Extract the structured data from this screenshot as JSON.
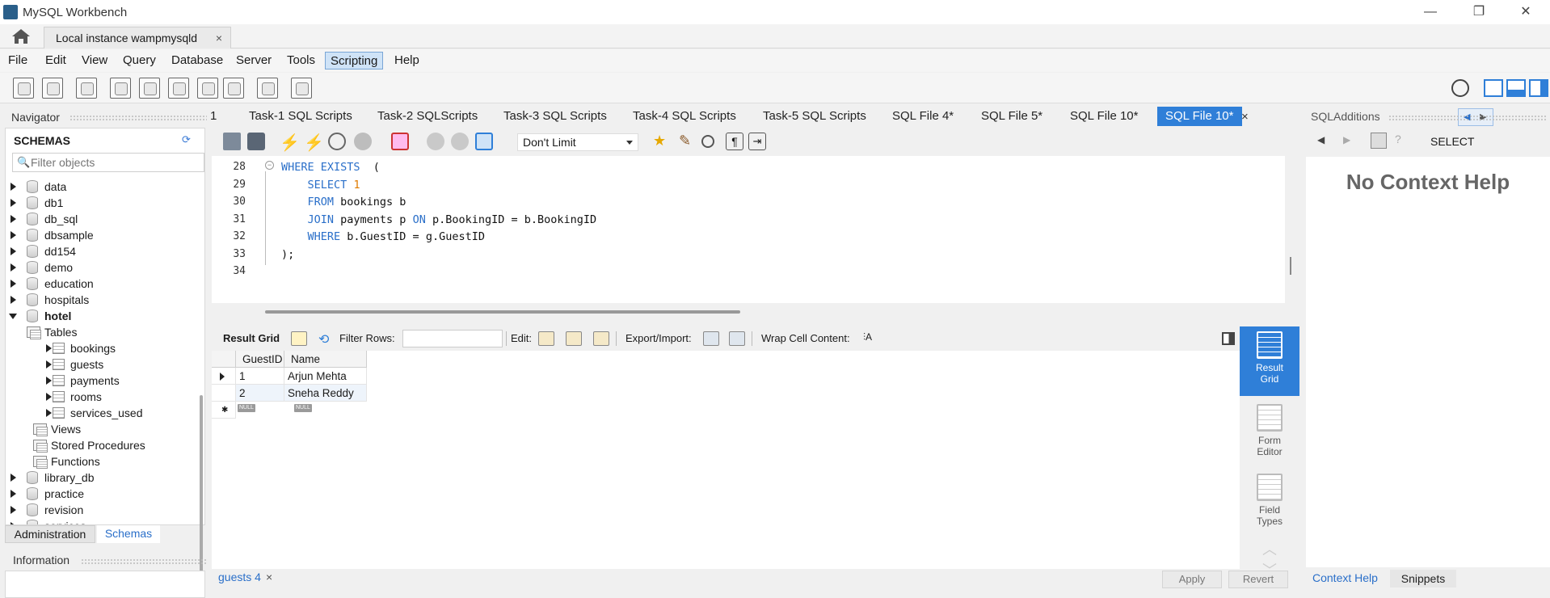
{
  "window": {
    "title": "MySQL Workbench",
    "minimize": "—",
    "restore": "❐",
    "close": "✕"
  },
  "connection_tab": {
    "label": "Local instance wampmysqld",
    "close": "×"
  },
  "menu": [
    "File",
    "Edit",
    "View",
    "Query",
    "Database",
    "Server",
    "Tools",
    "Scripting",
    "Help"
  ],
  "navigator": {
    "header": "Navigator",
    "schemas_title": "SCHEMAS",
    "filter_placeholder": "Filter objects",
    "tree": [
      {
        "label": "data",
        "level": 0,
        "expanded": false,
        "type": "schema"
      },
      {
        "label": "db1",
        "level": 0,
        "expanded": false,
        "type": "schema"
      },
      {
        "label": "db_sql",
        "level": 0,
        "expanded": false,
        "type": "schema"
      },
      {
        "label": "dbsample",
        "level": 0,
        "expanded": false,
        "type": "schema"
      },
      {
        "label": "dd154",
        "level": 0,
        "expanded": false,
        "type": "schema"
      },
      {
        "label": "demo",
        "level": 0,
        "expanded": false,
        "type": "schema"
      },
      {
        "label": "education",
        "level": 0,
        "expanded": false,
        "type": "schema"
      },
      {
        "label": "hospitals",
        "level": 0,
        "expanded": false,
        "type": "schema"
      },
      {
        "label": "hotel",
        "level": 0,
        "expanded": true,
        "type": "schema",
        "bold": true
      },
      {
        "label": "Tables",
        "level": 1,
        "expanded": true,
        "type": "folder"
      },
      {
        "label": "bookings",
        "level": 2,
        "expanded": false,
        "type": "table"
      },
      {
        "label": "guests",
        "level": 2,
        "expanded": false,
        "type": "table"
      },
      {
        "label": "payments",
        "level": 2,
        "expanded": false,
        "type": "table"
      },
      {
        "label": "rooms",
        "level": 2,
        "expanded": false,
        "type": "table"
      },
      {
        "label": "services_used",
        "level": 2,
        "expanded": false,
        "type": "table"
      },
      {
        "label": "Views",
        "level": 1,
        "expanded": null,
        "type": "folder"
      },
      {
        "label": "Stored Procedures",
        "level": 1,
        "expanded": null,
        "type": "folder"
      },
      {
        "label": "Functions",
        "level": 1,
        "expanded": null,
        "type": "folder"
      },
      {
        "label": "library_db",
        "level": 0,
        "expanded": false,
        "type": "schema"
      },
      {
        "label": "practice",
        "level": 0,
        "expanded": false,
        "type": "schema"
      },
      {
        "label": "revision",
        "level": 0,
        "expanded": false,
        "type": "schema"
      },
      {
        "label": "services",
        "level": 0,
        "expanded": false,
        "type": "schema"
      }
    ],
    "tabs": {
      "administration": "Administration",
      "schemas": "Schemas"
    },
    "info_header": "Information"
  },
  "editor_tabs": {
    "items": [
      "1",
      "Task-1 SQL Scripts",
      "Task-2 SQLScripts",
      "Task-3 SQL Scripts",
      "Task-4 SQL Scripts",
      "Task-5 SQL Scripts",
      "SQL File 4*",
      "SQL File 5*",
      "SQL File 10*",
      "SQL File 10*"
    ],
    "close": "×"
  },
  "editor_toolbar": {
    "limit": "Don't Limit"
  },
  "code": [
    {
      "n": "28",
      "parts": [
        [
          "kw",
          "WHERE EXISTS"
        ],
        [
          "",
          "  ("
        ]
      ]
    },
    {
      "n": "29",
      "parts": [
        [
          "",
          "    "
        ],
        [
          "kw",
          "SELECT"
        ],
        [
          "",
          " "
        ],
        [
          "num",
          "1"
        ]
      ]
    },
    {
      "n": "30",
      "parts": [
        [
          "",
          "    "
        ],
        [
          "kw",
          "FROM"
        ],
        [
          "",
          " bookings b"
        ]
      ]
    },
    {
      "n": "31",
      "parts": [
        [
          "",
          "    "
        ],
        [
          "kw",
          "JOIN"
        ],
        [
          "",
          " payments p "
        ],
        [
          "kw",
          "ON"
        ],
        [
          "",
          " p.BookingID = b.BookingID"
        ]
      ]
    },
    {
      "n": "32",
      "parts": [
        [
          "",
          "    "
        ],
        [
          "kw",
          "WHERE"
        ],
        [
          "",
          " b.GuestID = g.GuestID"
        ]
      ]
    },
    {
      "n": "33",
      "parts": [
        [
          "",
          ");"
        ]
      ]
    },
    {
      "n": "34",
      "parts": []
    }
  ],
  "result_toolbar": {
    "result_grid": "Result Grid",
    "filter_rows": "Filter Rows:",
    "edit": "Edit:",
    "export_import": "Export/Import:",
    "wrap": "Wrap Cell Content:"
  },
  "grid": {
    "columns": [
      "GuestID",
      "Name"
    ],
    "rows": [
      [
        "1",
        "Arjun Mehta"
      ],
      [
        "2",
        "Sneha Reddy"
      ]
    ],
    "null_label": "NULL"
  },
  "result_modes": [
    {
      "label_1": "Result",
      "label_2": "Grid"
    },
    {
      "label_1": "Form",
      "label_2": "Editor"
    },
    {
      "label_1": "Field",
      "label_2": "Types"
    }
  ],
  "bottom": {
    "result_tab": "guests 4",
    "close": "×",
    "apply": "Apply",
    "revert": "Revert"
  },
  "sql_additions": {
    "header": "SQLAdditions",
    "select": "SELECT",
    "context_help": "No Context Help",
    "tab_context": "Context Help",
    "tab_snippets": "Snippets"
  },
  "colors": {
    "accent": "#2f7fd8",
    "keyword": "#2a6fc9",
    "number": "#e07b00"
  }
}
